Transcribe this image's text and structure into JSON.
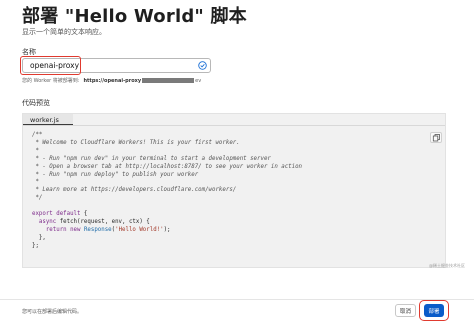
{
  "page": {
    "title": "部署 \"Hello World\" 脚本",
    "subtitle": "显示一个简单的文本响应。"
  },
  "name_section": {
    "label": "名称",
    "value": "openai-proxy",
    "route_prefix": "您的 Worker 将被部署到:",
    "route_protocol": "https://",
    "route_host": "openai-proxy",
    "route_suffix": "ev"
  },
  "code_section": {
    "label": "代码预览",
    "tab_label": "worker.js",
    "lines": [
      [
        {
          "t": "/**",
          "c": "comment"
        }
      ],
      [
        {
          "t": " * Welcome to Cloudflare Workers! This is your first worker.",
          "c": "comment"
        }
      ],
      [
        {
          "t": " *",
          "c": "comment"
        }
      ],
      [
        {
          "t": " * - Run \"npm run dev\" in your terminal to start a development server",
          "c": "comment"
        }
      ],
      [
        {
          "t": " * - Open a browser tab at http://localhost:8787/ to see your worker in action",
          "c": "comment"
        }
      ],
      [
        {
          "t": " * - Run \"npm run deploy\" to publish your worker",
          "c": "comment"
        }
      ],
      [
        {
          "t": " *",
          "c": "comment"
        }
      ],
      [
        {
          "t": " * Learn more at https://developers.cloudflare.com/workers/",
          "c": "comment"
        }
      ],
      [
        {
          "t": " */",
          "c": "comment"
        }
      ],
      [
        {
          "t": "",
          "c": ""
        }
      ],
      [
        {
          "t": "export default",
          "c": "kw"
        },
        {
          "t": " {",
          "c": ""
        }
      ],
      [
        {
          "t": "  async ",
          "c": "kw"
        },
        {
          "t": "fetch(request, env, ctx) {",
          "c": "fn"
        }
      ],
      [
        {
          "t": "    return new ",
          "c": "kw"
        },
        {
          "t": "Response",
          "c": "cls"
        },
        {
          "t": "(",
          "c": ""
        },
        {
          "t": "'Hello World!'",
          "c": "str"
        },
        {
          "t": ");",
          "c": ""
        }
      ],
      [
        {
          "t": "  },",
          "c": ""
        }
      ],
      [
        {
          "t": "};",
          "c": ""
        }
      ]
    ]
  },
  "watermark": "@稀土掘金技术社区",
  "footer": {
    "note": "您可以在部署后编辑代码。",
    "cancel_label": "取消",
    "deploy_label": "部署"
  },
  "colors": {
    "accent": "#0a5cc9",
    "highlight": "#e03a2f",
    "check": "#1a6fd6"
  }
}
